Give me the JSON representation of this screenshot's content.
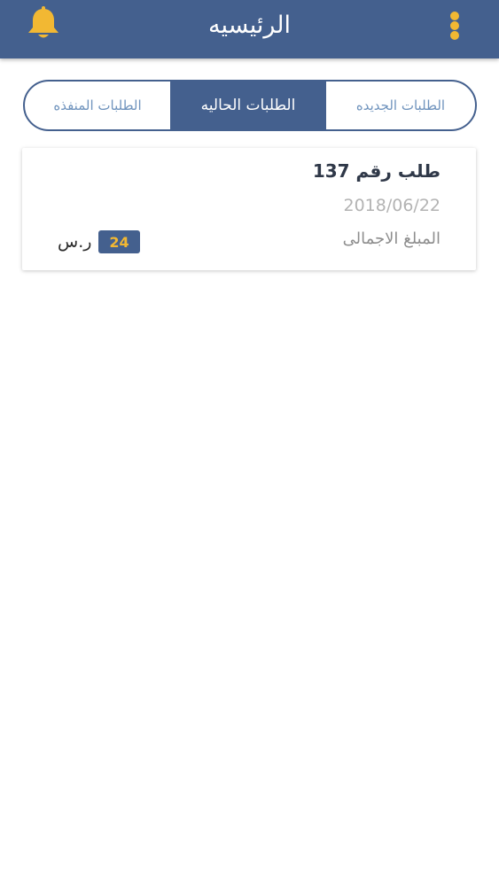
{
  "header": {
    "title": "الرئيسيه",
    "bell_icon": "bell-icon",
    "menu_icon": "more-vertical-icon"
  },
  "tabs": [
    {
      "label": "الطلبات الجديده",
      "active": false
    },
    {
      "label": "الطلبات الحاليه",
      "active": true
    },
    {
      "label": "الطلبات المنفذه",
      "active": false
    }
  ],
  "orders": [
    {
      "title": "طلب رقم 137",
      "date": "2018/06/22",
      "total_label": "المبلغ الاجمالى",
      "amount": "24",
      "currency": "ر.س"
    }
  ],
  "colors": {
    "primary": "#44608e",
    "accent": "#f2b833",
    "tab_inactive_text": "#6f93bd",
    "date_text": "#b3b3b3"
  }
}
